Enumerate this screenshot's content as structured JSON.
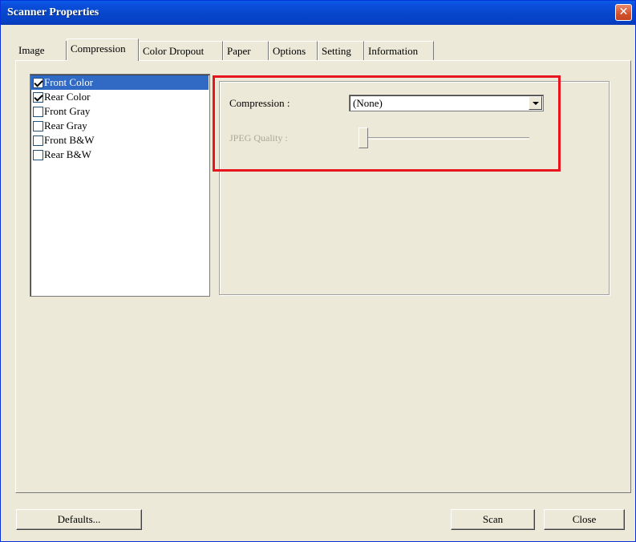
{
  "window": {
    "title": "Scanner Properties",
    "close_glyph": "✕"
  },
  "tabs": [
    {
      "label": "Image"
    },
    {
      "label": "Compression"
    },
    {
      "label": "Color Dropout"
    },
    {
      "label": "Paper"
    },
    {
      "label": "Options"
    },
    {
      "label": "Setting"
    },
    {
      "label": "Information"
    }
  ],
  "active_tab": "Compression",
  "image_list": [
    {
      "label": "Front Color",
      "checked": true,
      "selected": true
    },
    {
      "label": "Rear Color",
      "checked": true,
      "selected": false
    },
    {
      "label": "Front Gray",
      "checked": false,
      "selected": false
    },
    {
      "label": "Rear Gray",
      "checked": false,
      "selected": false
    },
    {
      "label": "Front B&W",
      "checked": false,
      "selected": false
    },
    {
      "label": "Rear B&W",
      "checked": false,
      "selected": false
    }
  ],
  "compression": {
    "label": "Compression :",
    "value": "(None)",
    "jpeg_quality_label": "JPEG Quality :",
    "jpeg_quality_enabled": false
  },
  "buttons": {
    "defaults": "Defaults...",
    "scan": "Scan",
    "close": "Close"
  },
  "colors": {
    "titlebar": "#0747cc",
    "dialog_bg": "#ece9d8",
    "selection": "#316ac5",
    "highlight_box": "#e8141e"
  }
}
